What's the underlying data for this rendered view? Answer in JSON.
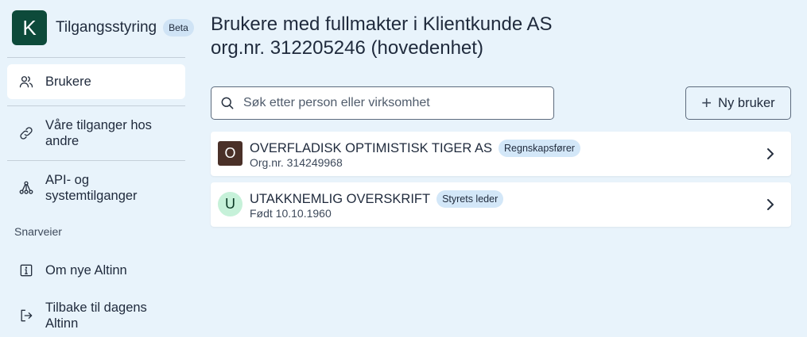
{
  "app": {
    "logo_letter": "K",
    "title": "Tilgangsstyring",
    "badge": "Beta"
  },
  "sidebar": {
    "items": [
      {
        "label": "Brukere",
        "icon": "users-icon",
        "active": true
      },
      {
        "label": "Våre tilganger hos andre",
        "icon": "link-icon",
        "active": false
      },
      {
        "label": "API- og systemtilganger",
        "icon": "network-icon",
        "active": false
      }
    ],
    "shortcuts_title": "Snarveier",
    "shortcuts": [
      {
        "label": "Om nye Altinn",
        "icon": "info-icon"
      },
      {
        "label": "Tilbake til dagens Altinn",
        "icon": "exit-icon"
      }
    ]
  },
  "main": {
    "title_line1": "Brukere med fullmakter i Klientkunde AS",
    "title_line2": "org.nr. 312205246 (hovedenhet)",
    "search_placeholder": "Søk etter person eller virksomhet",
    "new_user_label": "Ny bruker",
    "users": [
      {
        "avatar": "O",
        "name": "OVERFLADISK OPTIMISTISK TIGER AS",
        "role": "Regnskapsfører",
        "sub": "Org.nr. 314249968",
        "type": "org"
      },
      {
        "avatar": "U",
        "name": "UTAKKNEMLIG OVERSKRIFT",
        "role": "Styrets leder",
        "sub": "Født 10.10.1960",
        "type": "person"
      }
    ]
  },
  "colors": {
    "background": "#e8f3fb",
    "brand": "#0d4a3a",
    "badge": "#d3e7f8",
    "org_avatar": "#4a3028",
    "person_avatar": "#c6f1d9"
  }
}
